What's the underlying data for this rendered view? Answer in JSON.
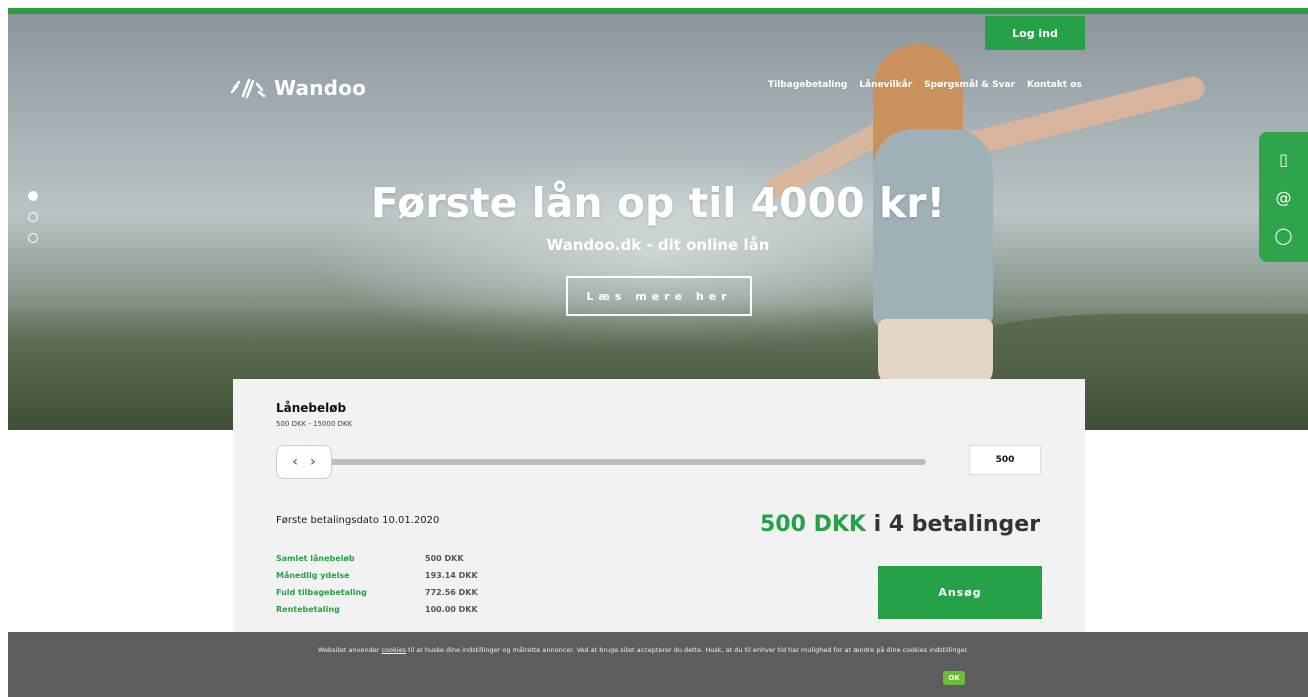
{
  "header": {
    "brand": "Wandoo",
    "login_label": "Log ind",
    "nav": [
      "Tilbagebetaling",
      "Lånevilkår",
      "Spørgsmål & Svar",
      "Kontakt os"
    ]
  },
  "hero": {
    "title": "Første lån op til 4000 kr!",
    "subtitle": "Wandoo.dk - dit online lån",
    "cta_label": "Læs mere her",
    "slides_count": 3,
    "active_slide": 1
  },
  "side_contacts": {
    "icons": [
      "phone-icon",
      "email-at-icon",
      "chat-bubble-icon"
    ],
    "phone_glyph": "▯",
    "email_glyph": "@",
    "chat_glyph": "◯"
  },
  "calculator": {
    "title": "Lånebeløb",
    "range": "500 DKK - 15000 DKK",
    "amount_value": "500",
    "slider_fraction": 0.0,
    "first_payment": "Første betalingsdato 10.01.2020",
    "summary_amount": "500 DKK",
    "summary_rest": " i 4 betalinger",
    "details": [
      {
        "label": "Samlet lånebeløb",
        "value": "500 DKK"
      },
      {
        "label": "Månedlig ydelse",
        "value": "193.14 DKK"
      },
      {
        "label": "Fuld tilbagebetaling",
        "value": "772.56 DKK"
      },
      {
        "label": "Rentebetaling",
        "value": "100.00 DKK"
      }
    ],
    "apply_label": "Ansøg"
  },
  "cookie": {
    "text_before": "Websitet anvender ",
    "link_text": "cookies",
    "text_after": " til at huske dine indstillinger og målrette annoncer. Ved at bruge sitet accepterer du dette. Husk, at du til enhver tid har mulighed for at ændre på dine cookies indstillinger.",
    "ok_label": "OK"
  },
  "colors": {
    "accent": "#27a147",
    "cookie_ok": "#6dbb3a"
  }
}
